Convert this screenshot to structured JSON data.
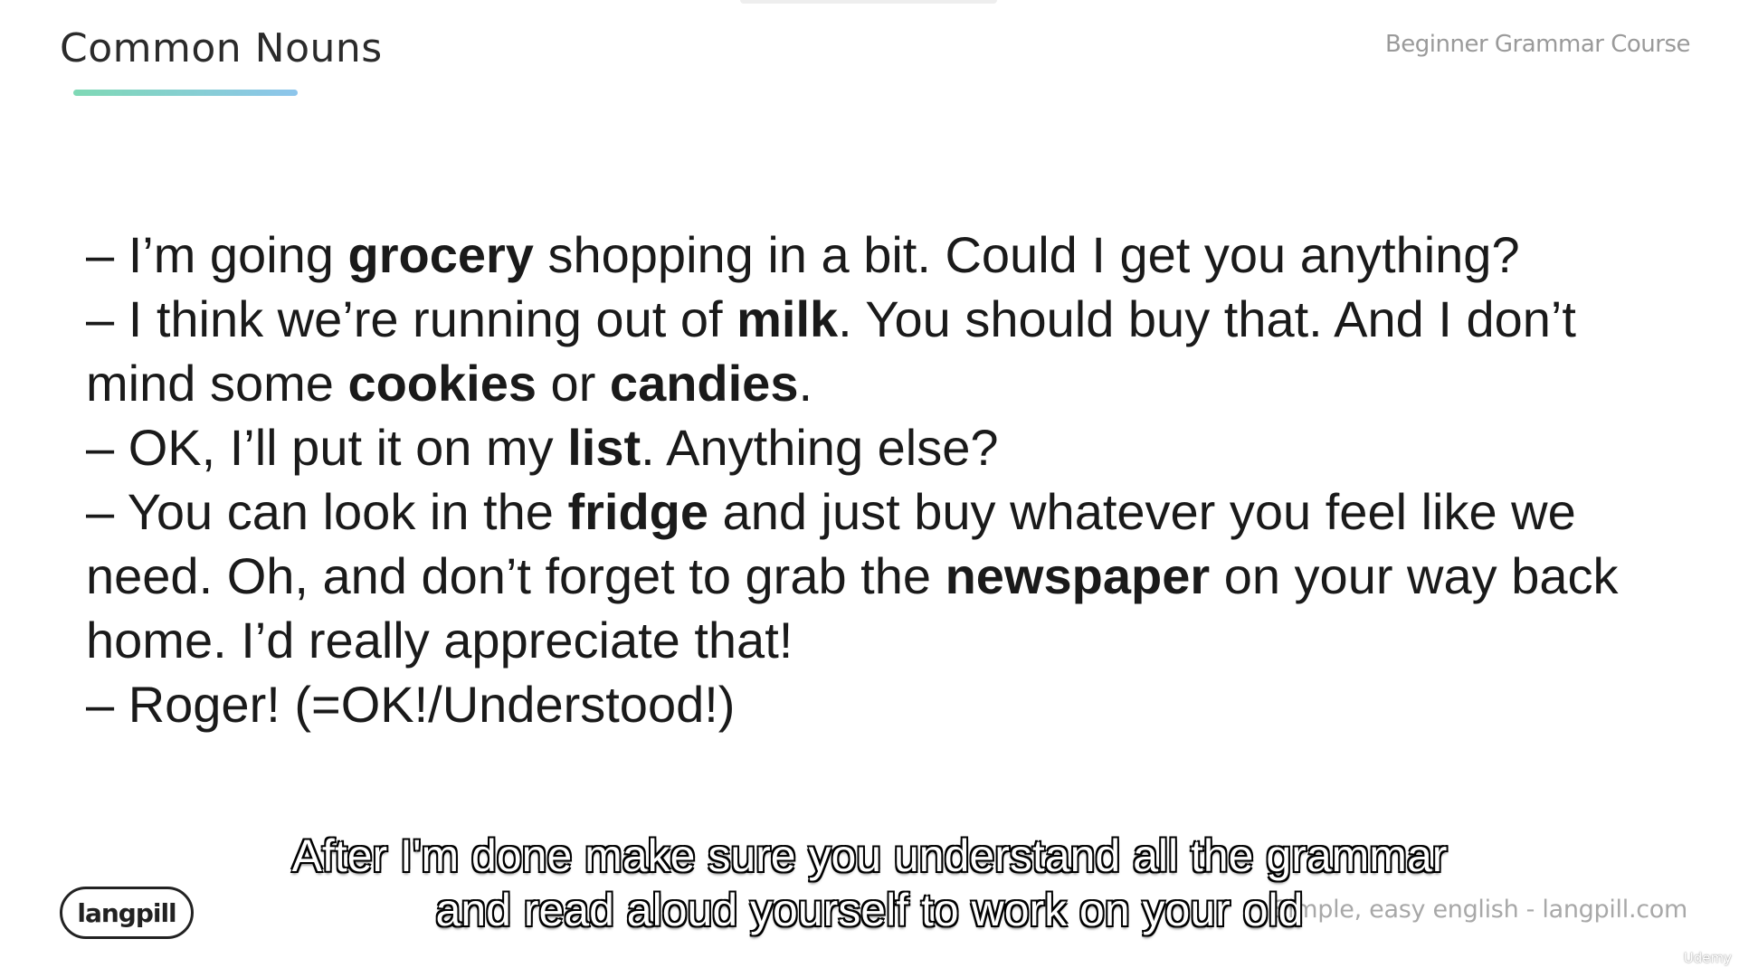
{
  "slide": {
    "title": "Common Nouns",
    "course": "Beginner Grammar Course",
    "underline_color_start": "#7fd9b5",
    "underline_color_end": "#8dc5ec",
    "dialogue": [
      [
        {
          "t": "– I’m going ",
          "b": false
        },
        {
          "t": "grocery",
          "b": true
        },
        {
          "t": " shopping in a bit. Could I get you anything?",
          "b": false
        }
      ],
      [
        {
          "t": "– I think we’re running out of ",
          "b": false
        },
        {
          "t": "milk",
          "b": true
        },
        {
          "t": ". You should buy that. And I don’t mind some ",
          "b": false
        },
        {
          "t": "cookies",
          "b": true
        },
        {
          "t": " or ",
          "b": false
        },
        {
          "t": "candies",
          "b": true
        },
        {
          "t": ".",
          "b": false
        }
      ],
      [
        {
          "t": "– OK, I’ll put it on my ",
          "b": false
        },
        {
          "t": "list",
          "b": true
        },
        {
          "t": ". Anything else?",
          "b": false
        }
      ],
      [
        {
          "t": "– You can look in the ",
          "b": false
        },
        {
          "t": "fridge",
          "b": true
        },
        {
          "t": " and just buy whatever you feel like we need. Oh, and don’t forget to grab the ",
          "b": false
        },
        {
          "t": "newspaper",
          "b": true
        },
        {
          "t": " on your way back home. I’d really appreciate that!",
          "b": false
        }
      ],
      [
        {
          "t": "– Roger! (=OK!/Understood!)",
          "b": false
        }
      ]
    ],
    "logo": "langpill",
    "footer": "Simple, easy english - langpill.com"
  },
  "subtitles": {
    "line1": "After I'm done make sure you understand all the grammar",
    "line2": "and read aloud yourself to work on your old"
  },
  "watermark": {
    "label": "Udemy",
    "icon": "udemy-logo-icon"
  }
}
